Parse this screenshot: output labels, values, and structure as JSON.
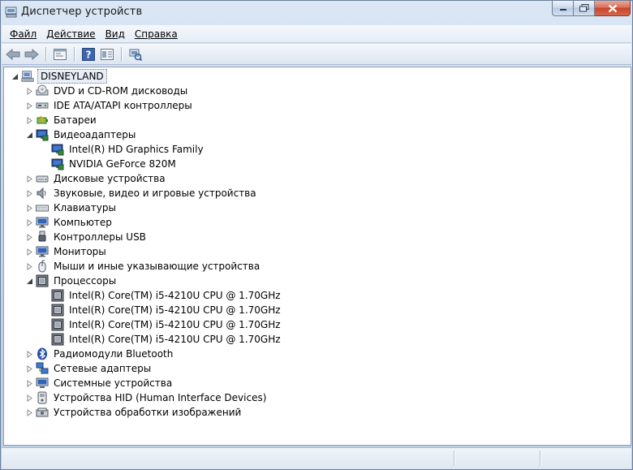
{
  "window": {
    "title": "Диспетчер устройств",
    "accent": "#c4d5ea",
    "close_color": "#c7452b"
  },
  "menu": {
    "items": [
      {
        "label": "Файл"
      },
      {
        "label": "Действие"
      },
      {
        "label": "Вид"
      },
      {
        "label": "Справка"
      }
    ]
  },
  "toolbar": {
    "buttons": [
      "back-arrow-icon",
      "forward-arrow-icon",
      "properties-icon",
      "help-icon",
      "view-icon",
      "scan-hardware-icon"
    ]
  },
  "tree": {
    "root": {
      "label": "DISNEYLAND",
      "icon": "computer-icon",
      "expanded": true
    },
    "categories": [
      {
        "label": "DVD и CD-ROM дисководы",
        "icon": "dvd-drive-icon",
        "expanded": false,
        "children": []
      },
      {
        "label": "IDE ATA/ATAPI контроллеры",
        "icon": "ide-controller-icon",
        "expanded": false,
        "children": []
      },
      {
        "label": "Батареи",
        "icon": "battery-icon",
        "expanded": false,
        "children": []
      },
      {
        "label": "Видеоадаптеры",
        "icon": "display-adapter-icon",
        "expanded": true,
        "children": [
          {
            "label": "Intel(R) HD Graphics Family",
            "icon": "display-adapter-icon"
          },
          {
            "label": "NVIDIA GeForce 820M",
            "icon": "display-adapter-icon"
          }
        ]
      },
      {
        "label": "Дисковые устройства",
        "icon": "disk-drive-icon",
        "expanded": false,
        "children": []
      },
      {
        "label": "Звуковые, видео и игровые устройства",
        "icon": "speaker-icon",
        "expanded": false,
        "children": []
      },
      {
        "label": "Клавиатуры",
        "icon": "keyboard-icon",
        "expanded": false,
        "children": []
      },
      {
        "label": "Компьютер",
        "icon": "monitor-icon",
        "expanded": false,
        "children": []
      },
      {
        "label": "Контроллеры USB",
        "icon": "usb-icon",
        "expanded": false,
        "children": []
      },
      {
        "label": "Мониторы",
        "icon": "monitor-icon",
        "expanded": false,
        "children": []
      },
      {
        "label": "Мыши и иные указывающие устройства",
        "icon": "mouse-icon",
        "expanded": false,
        "children": []
      },
      {
        "label": "Процессоры",
        "icon": "processor-icon",
        "expanded": true,
        "children": [
          {
            "label": "Intel(R) Core(TM) i5-4210U CPU @ 1.70GHz",
            "icon": "processor-icon"
          },
          {
            "label": "Intel(R) Core(TM) i5-4210U CPU @ 1.70GHz",
            "icon": "processor-icon"
          },
          {
            "label": "Intel(R) Core(TM) i5-4210U CPU @ 1.70GHz",
            "icon": "processor-icon"
          },
          {
            "label": "Intel(R) Core(TM) i5-4210U CPU @ 1.70GHz",
            "icon": "processor-icon"
          }
        ]
      },
      {
        "label": "Радиомодули Bluetooth",
        "icon": "bluetooth-icon",
        "expanded": false,
        "children": []
      },
      {
        "label": "Сетевые адаптеры",
        "icon": "network-adapter-icon",
        "expanded": false,
        "children": []
      },
      {
        "label": "Системные устройства",
        "icon": "system-device-icon",
        "expanded": false,
        "children": []
      },
      {
        "label": "Устройства HID (Human Interface Devices)",
        "icon": "hid-icon",
        "expanded": false,
        "children": []
      },
      {
        "label": "Устройства обработки изображений",
        "icon": "imaging-device-icon",
        "expanded": false,
        "children": []
      }
    ]
  }
}
